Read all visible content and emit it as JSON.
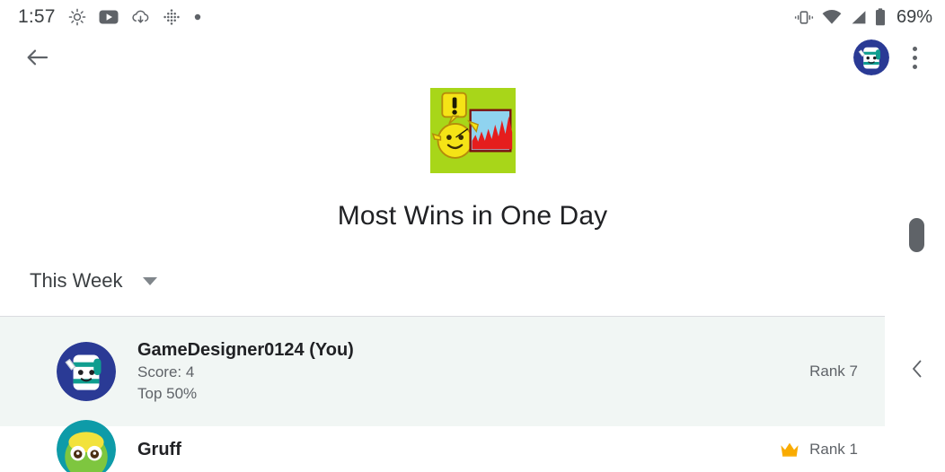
{
  "status_bar": {
    "time": "1:57",
    "battery_percent": "69%",
    "left_icons": [
      "brightness-icon",
      "youtube-icon",
      "cloud-download-icon",
      "dots-grid-icon",
      "dot-icon"
    ],
    "right_icons": [
      "vibrate-icon",
      "wifi-icon",
      "cellular-signal-icon",
      "battery-icon"
    ]
  },
  "app_bar": {
    "back_icon": "back-arrow-icon",
    "avatar": "player-avatar",
    "overflow_icon": "more-options-icon"
  },
  "achievement": {
    "badge_icon": "achievement-badge-icon",
    "title": "Most Wins in One Day"
  },
  "filter": {
    "selected": "This Week",
    "caret_icon": "chevron-down-icon"
  },
  "leaderboard": {
    "rows": [
      {
        "name": "GameDesigner0124 (You)",
        "score": "Score: 4",
        "percentile": "Top 50%",
        "rank": "Rank 7",
        "crown": false,
        "highlighted": true
      },
      {
        "name": "Gruff",
        "rank": "Rank 1",
        "crown": true,
        "highlighted": false
      }
    ]
  },
  "system_nav": {
    "scrollbar": "scrollbar-thumb",
    "back_gesture_icon": "back-gesture-chevron-icon"
  },
  "colors": {
    "highlight_row": "#f1f6f4",
    "divider": "#dadce0",
    "crown": "#f9ab00",
    "badge_green": "#a8d619",
    "text_primary": "#202124",
    "text_secondary": "#5f6368"
  }
}
